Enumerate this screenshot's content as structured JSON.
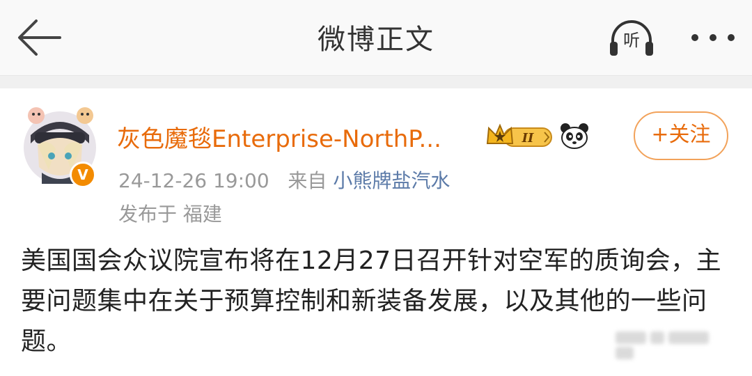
{
  "header": {
    "title": "微博正文",
    "listen_label": "听",
    "icons": {
      "back": "back-arrow-icon",
      "listen": "headphones-icon",
      "more": "more-dots-icon"
    }
  },
  "post": {
    "username": "灰色魔毯Enterprise-NorthP...",
    "timestamp": "24-12-26 19:00",
    "source_prefix": "来自",
    "source": "小熊牌盐汽水",
    "location": "发布于 福建",
    "follow_label": "+关注",
    "verified_badge": "V",
    "level_badge": "II",
    "content": "美国国会众议院宣布将在12月27日召开针对空军的质询会，主要问题集中在关于预算控制和新装备发展，以及其他的一些问题。"
  },
  "colors": {
    "accent_orange": "#e86b0b",
    "source_blue": "#5b7aa8",
    "meta_gray": "#999999",
    "verified_orange": "#f38b00"
  }
}
